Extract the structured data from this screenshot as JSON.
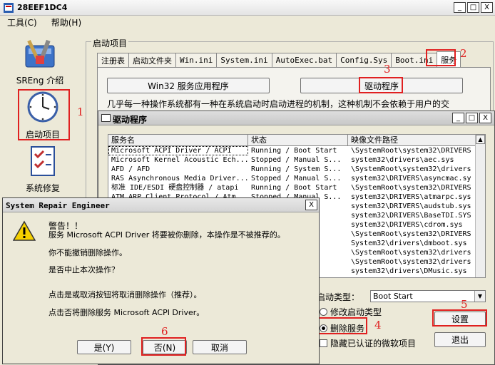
{
  "main_window": {
    "title": "28EEF1DC4",
    "btn_min": "_",
    "btn_max": "□",
    "btn_close": "X"
  },
  "menu": [
    {
      "label": "工具(C)"
    },
    {
      "label": "帮助(H)"
    }
  ],
  "sidebar": {
    "items": [
      {
        "label": "SREng 介绍",
        "icon": "toolbox-icon"
      },
      {
        "label": "启动项目",
        "icon": "clock-icon"
      },
      {
        "label": "系统修复",
        "icon": "checklist-icon"
      }
    ]
  },
  "annotations": {
    "n1": "1",
    "n2": "2",
    "n3": "3",
    "n4": "4",
    "n5": "5",
    "n6": "6"
  },
  "startup_group": {
    "title": "启动项目"
  },
  "tabs": [
    {
      "label": "注册表"
    },
    {
      "label": "启动文件夹"
    },
    {
      "label": "Win.ini"
    },
    {
      "label": "System.ini"
    },
    {
      "label": "AutoExec.bat"
    },
    {
      "label": "Config.Sys"
    },
    {
      "label": "Boot.ini"
    },
    {
      "label": "服务"
    }
  ],
  "service_buttons": {
    "win32": "Win32 服务应用程序",
    "driver": "驱动程序"
  },
  "description": "几乎每一种操作系统都有一种在系统启动时启动进程的机制，这种机制不会依赖于用户的交",
  "driver_window": {
    "title": "驱动程序",
    "btn_min": "_",
    "btn_max": "□",
    "btn_close": "X",
    "columns": [
      "服务名",
      "状态",
      "映像文件路径"
    ],
    "rows": [
      [
        "Microsoft ACPI Driver / ACPI",
        "Running / Boot Start",
        "\\SystemRoot\\system32\\DRIVERS"
      ],
      [
        "Microsoft Kernel Acoustic Ech...",
        "Stopped / Manual S...",
        "system32\\drivers\\aec.sys"
      ],
      [
        "AFD / AFD",
        "Running / System S...",
        "\\SystemRoot\\system32\\drivers"
      ],
      [
        "RAS Asynchronous Media Driver...",
        "Stopped / Manual S...",
        "system32\\DRIVERS\\asyncmac.sy"
      ],
      [
        "标准 IDE/ESDI 硬盘控制器 / atapi",
        "Running / Boot Start",
        "\\SystemRoot\\system32\\DRIVERS"
      ],
      [
        "ATM ARP Client Protocol / Atm...",
        "Stopped / Manual S...",
        "system32\\DRIVERS\\atmarpc.sys"
      ],
      [
        "",
        "Start",
        "system32\\DRIVERS\\audstub.sys"
      ],
      [
        "",
        "Start",
        "system32\\DRIVERS\\BaseTDI.SYS"
      ],
      [
        "",
        "n S...",
        "system32\\DRIVERS\\cdrom.sys"
      ],
      [
        "",
        "Start",
        "\\SystemRoot\\system32\\DRIVERS"
      ],
      [
        "",
        "led",
        "System32\\drivers\\dmboot.sys"
      ],
      [
        "",
        "Start",
        "\\SystemRoot\\system32\\drivers"
      ],
      [
        "",
        "Start",
        "\\SystemRoot\\system32\\drivers"
      ],
      [
        "",
        "Start",
        "system32\\drivers\\DMusic.sys"
      ]
    ],
    "startup_type_label": "启动类型：",
    "startup_type_value": "Boot Start",
    "modify_startup": "修改启动类型",
    "delete_service": "删除服务",
    "hide_ms": "隐藏已认证的微软项目",
    "settings_btn": "设置",
    "exit_btn": "退出"
  },
  "dialog": {
    "title": "System Repair Engineer",
    "close": "X",
    "line1": "警告！！",
    "line2": "服务 Microsoft ACPI Driver 将要被你删除，本操作是不被推荐的。",
    "line3": "你不能撤销删除操作。",
    "line4": "是否中止本次操作？",
    "line5": "点击是或取消按钮将取消删除操作（推荐）。",
    "line6": "点击否将删除服务 Microsoft ACPI Driver。",
    "btn_yes": "是(Y)",
    "btn_no": "否(N)",
    "btn_cancel": "取消"
  }
}
